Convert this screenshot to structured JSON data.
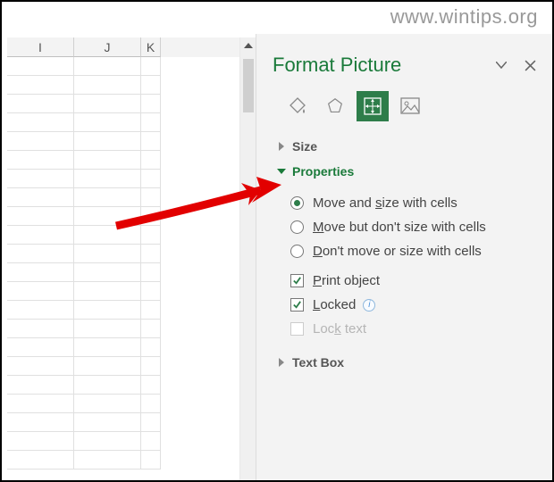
{
  "watermark": "www.wintips.org",
  "sheet": {
    "columns": [
      "I",
      "J",
      "K"
    ]
  },
  "panel": {
    "title": "Format Picture",
    "sections": {
      "size": {
        "label": "Size",
        "expanded": false
      },
      "properties": {
        "label": "Properties",
        "expanded": true,
        "radios": [
          {
            "selected": true,
            "pre": "Move and ",
            "u": "s",
            "post": "ize with cells"
          },
          {
            "selected": false,
            "pre": "",
            "u": "M",
            "post": "ove but don't size with cells"
          },
          {
            "selected": false,
            "pre": "",
            "u": "D",
            "post": "on't move or size with cells"
          }
        ],
        "checks": [
          {
            "checked": true,
            "disabled": false,
            "pre": "",
            "u": "P",
            "post": "rint object",
            "info": false
          },
          {
            "checked": true,
            "disabled": false,
            "pre": "",
            "u": "L",
            "post": "ocked",
            "info": true
          },
          {
            "checked": false,
            "disabled": true,
            "pre": "Loc",
            "u": "k",
            "post": " text",
            "info": false
          }
        ]
      },
      "textbox": {
        "label": "Text Box",
        "expanded": false
      }
    }
  }
}
